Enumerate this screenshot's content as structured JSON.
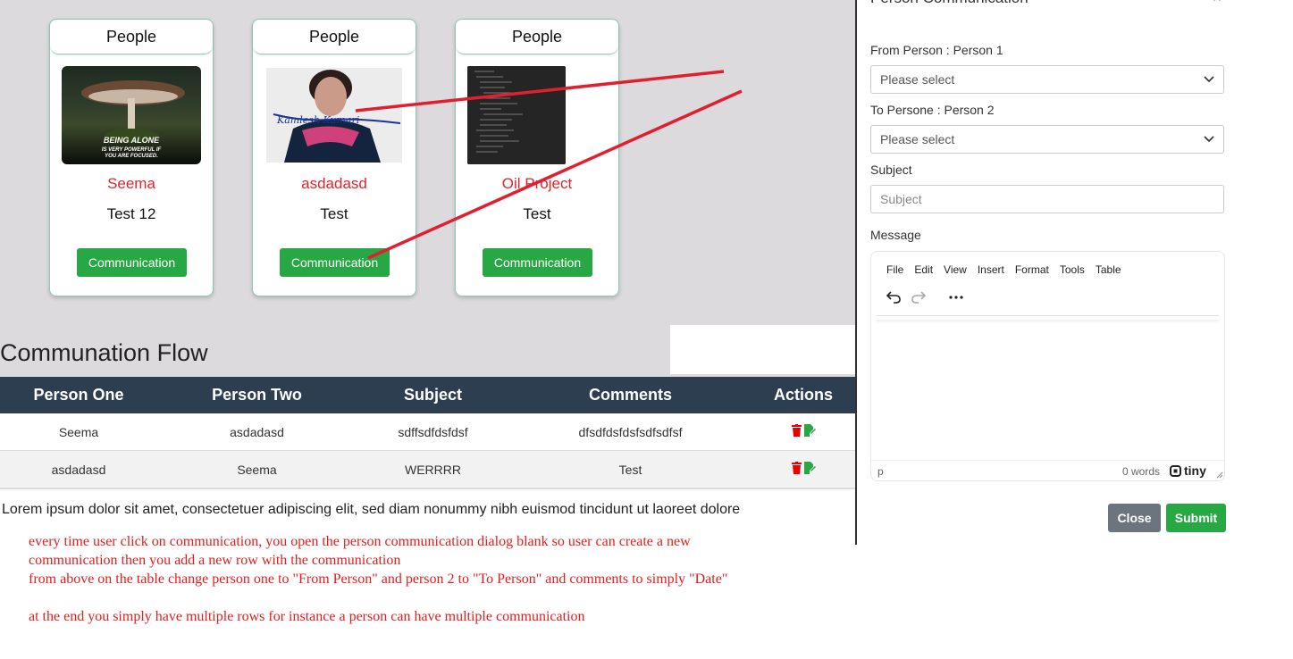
{
  "cards": [
    {
      "header": "People",
      "name": "Seema",
      "desc": "Test 12",
      "button": "Communication",
      "image_caption": "BEING ALONE IS VERY POWERFUL IF YOU ARE FOCUSED."
    },
    {
      "header": "People",
      "name": "asdadasd",
      "desc": "Test",
      "button": "Communication"
    },
    {
      "header": "People",
      "name": "Oil Project",
      "desc": "Test",
      "button": "Communication"
    }
  ],
  "flow": {
    "title": "Communation Flow",
    "columns": [
      "Person One",
      "Person Two",
      "Subject",
      "Comments",
      "Actions"
    ],
    "rows": [
      {
        "person_one": "Seema",
        "person_two": "asdadasd",
        "subject": "sdffsdfdsfdsf",
        "comments": "dfsdfdsfdsfsdfsdfsf"
      },
      {
        "person_one": "asdadasd",
        "person_two": "Seema",
        "subject": "WERRRR",
        "comments": "Test"
      }
    ]
  },
  "lorem": "Lorem ipsum dolor sit amet, consectetuer adipiscing elit, sed diam nonummy nibh euismod tincidunt ut laoreet dolore",
  "notes": {
    "line1": "every time user click on communication, you open the person communication dialog blank so user can create a new communication then you add a new row with the communication",
    "line2": "from above on the table change person one to \"From Person\" and person 2 to \"To Person\" and comments to simply \"Date\"",
    "line3": "at the end you simply have multiple rows for instance a person can have multiple communication"
  },
  "modal": {
    "title": "Person Communication",
    "close_icon": "×",
    "from_label": "From Person : Person 1",
    "from_value": "Please select",
    "to_label": "To Persone : Person 2",
    "to_value": "Please select",
    "subject_label": "Subject",
    "subject_placeholder": "Subject",
    "message_label": "Message",
    "editor_menu": [
      "File",
      "Edit",
      "View",
      "Insert",
      "Format",
      "Tools",
      "Table"
    ],
    "status_path": "p",
    "word_count": "0 words",
    "brand": "tiny",
    "close_button": "Close",
    "submit_button": "Submit"
  },
  "colors": {
    "accent_green": "#28a745",
    "name_red": "#e0242e",
    "table_header": "#2c3e50",
    "close_grey": "#6c757d",
    "annotation_red": "#e0201f"
  }
}
